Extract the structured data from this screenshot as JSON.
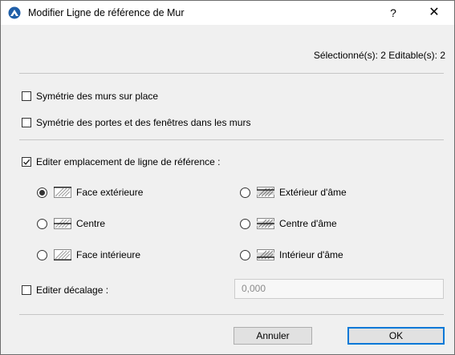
{
  "window": {
    "title": "Modifier Ligne de référence de Mur",
    "help_label": "?",
    "close_label": "✕"
  },
  "selection_info": "Sélectionné(s): 2 Editable(s): 2",
  "options": {
    "mirror_walls": {
      "label": "Symétrie des murs sur place",
      "checked": false
    },
    "mirror_doors": {
      "label": "Symétrie des portes et des fenêtres dans les murs",
      "checked": false
    },
    "edit_location": {
      "label": "Editer emplacement de ligne de référence :",
      "checked": true
    }
  },
  "reference_lines": [
    {
      "label": "Face extérieure",
      "selected": true,
      "icon": "wall-outer-face-icon"
    },
    {
      "label": "Centre",
      "selected": false,
      "icon": "wall-center-icon"
    },
    {
      "label": "Face intérieure",
      "selected": false,
      "icon": "wall-inner-face-icon"
    },
    {
      "label": "Extérieur d'âme",
      "selected": false,
      "icon": "wall-core-outside-icon"
    },
    {
      "label": "Centre d'âme",
      "selected": false,
      "icon": "wall-core-center-icon"
    },
    {
      "label": "Intérieur d'âme",
      "selected": false,
      "icon": "wall-core-inside-icon"
    }
  ],
  "offset": {
    "label": "Editer décalage :",
    "checked": false,
    "value": "0,000"
  },
  "buttons": {
    "cancel": "Annuler",
    "ok": "OK"
  },
  "colors": {
    "accent": "#0078d7",
    "dialog_bg": "#f0f0f0"
  }
}
